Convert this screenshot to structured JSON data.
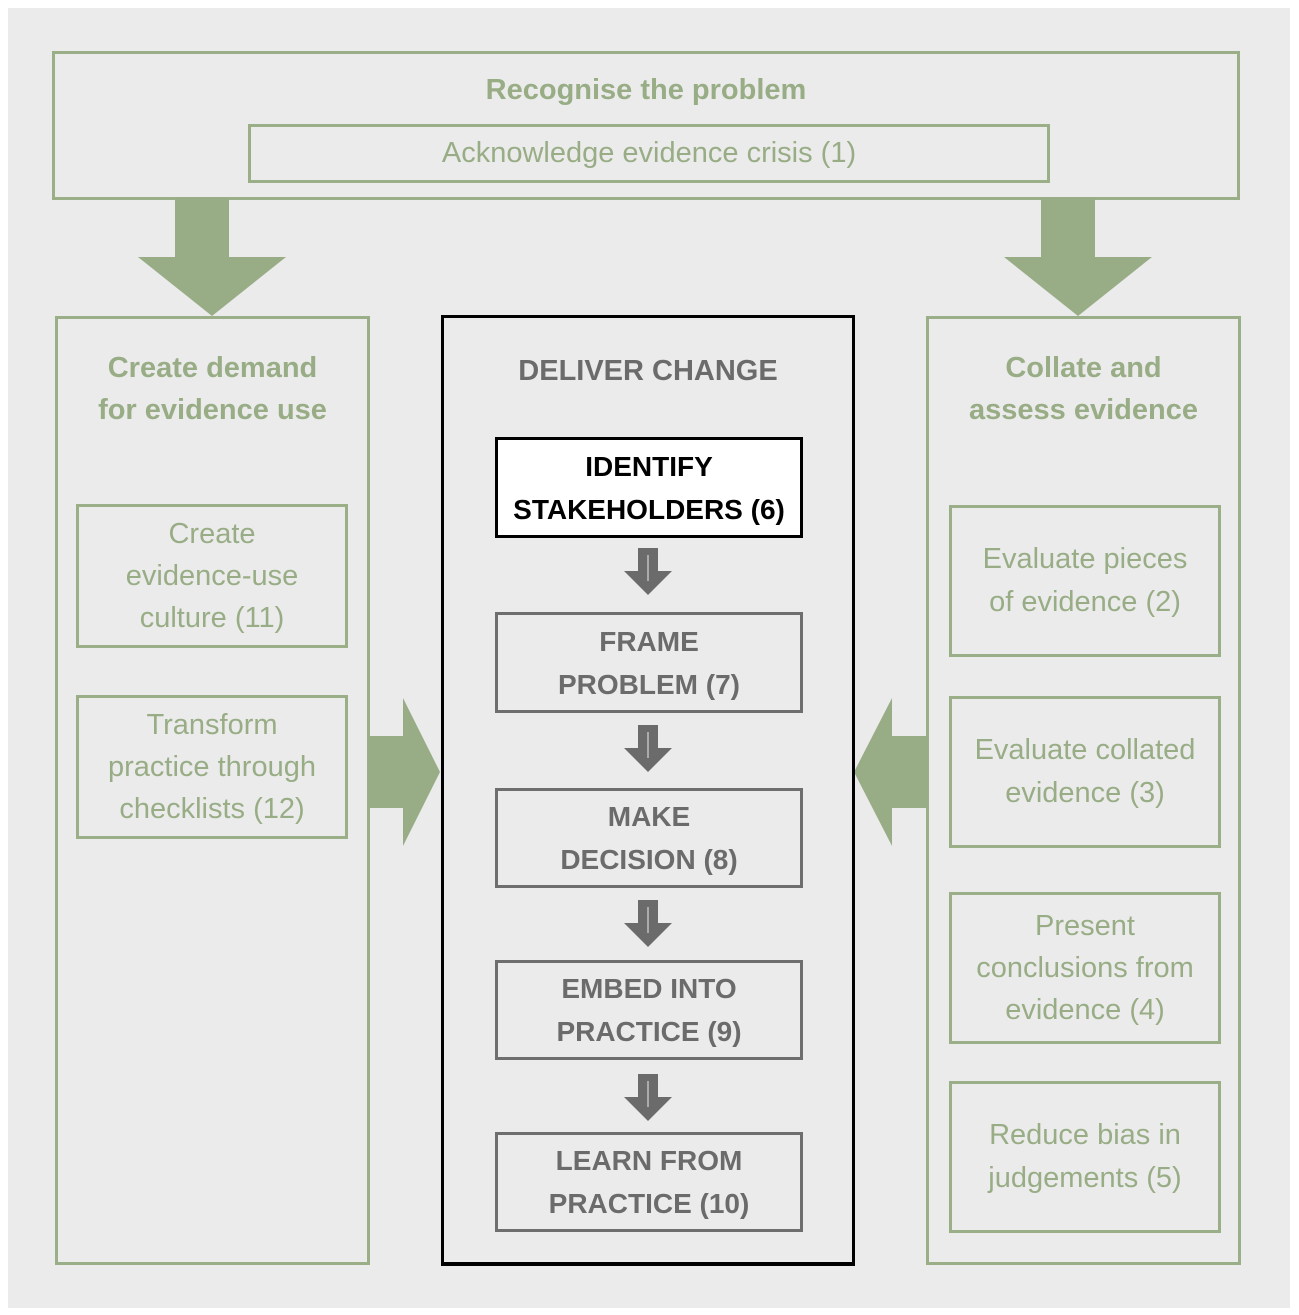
{
  "colors": {
    "background": "#ebebeb",
    "green": "#98ad85",
    "gray": "#6b6b6b",
    "black": "#000000",
    "highlight_fill": "#ffffff"
  },
  "top": {
    "title": "Recognise the problem",
    "step": "Acknowledge evidence crisis (1)"
  },
  "left": {
    "title_line1": "Create demand",
    "title_line2": "for evidence use",
    "steps": [
      {
        "lines": [
          "Create",
          "evidence-use",
          "culture (11)"
        ]
      },
      {
        "lines": [
          "Transform",
          "practice through",
          "checklists (12)"
        ]
      }
    ]
  },
  "center": {
    "title": "DELIVER CHANGE",
    "steps": [
      {
        "lines": [
          "IDENTIFY",
          "STAKEHOLDERS (6)"
        ],
        "highlighted": true
      },
      {
        "lines": [
          "FRAME",
          "PROBLEM (7)"
        ],
        "highlighted": false
      },
      {
        "lines": [
          "MAKE",
          "DECISION (8)"
        ],
        "highlighted": false
      },
      {
        "lines": [
          "EMBED INTO",
          "PRACTICE (9)"
        ],
        "highlighted": false
      },
      {
        "lines": [
          "LEARN FROM",
          "PRACTICE (10)"
        ],
        "highlighted": false
      }
    ]
  },
  "right": {
    "title_line1": "Collate and",
    "title_line2": "assess evidence",
    "steps": [
      {
        "lines": [
          "Evaluate pieces",
          "of evidence (2)"
        ]
      },
      {
        "lines": [
          "Evaluate collated",
          "evidence (3)"
        ]
      },
      {
        "lines": [
          "Present",
          "conclusions from",
          "evidence (4)"
        ]
      },
      {
        "lines": [
          "Reduce bias in",
          "judgements (5)"
        ]
      }
    ]
  }
}
